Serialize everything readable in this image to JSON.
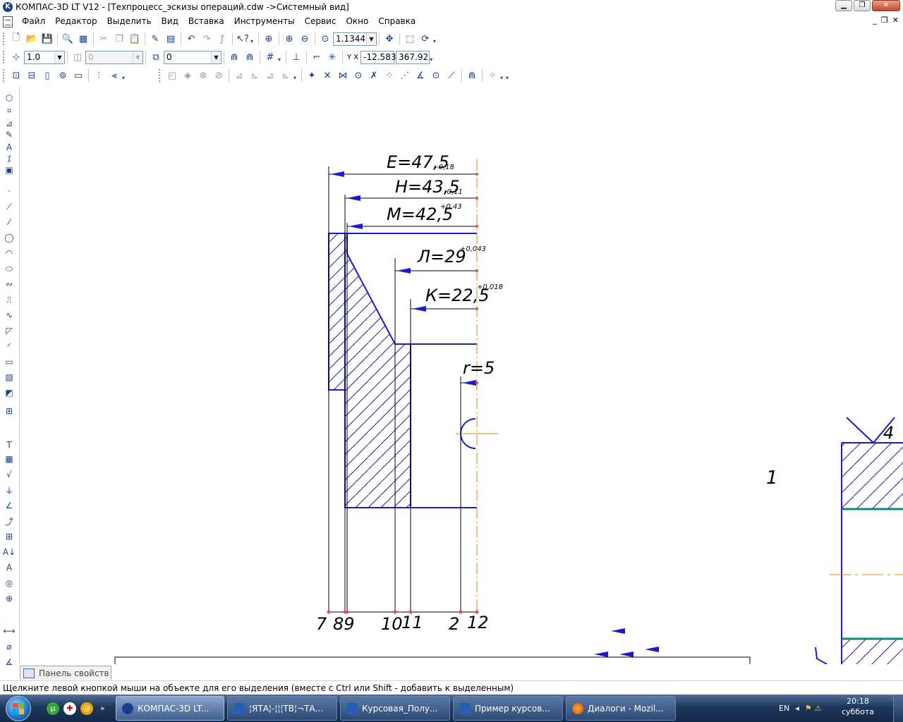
{
  "window": {
    "title": "КОМПАС-3D LT V12 - [Техпроцесс_эскизы операций.cdw ->Системный вид]"
  },
  "menu": {
    "items": [
      "Файл",
      "Редактор",
      "Выделить",
      "Вид",
      "Вставка",
      "Инструменты",
      "Сервис",
      "Окно",
      "Справка"
    ]
  },
  "toolbar": {
    "zoom_value": "1.1344",
    "line_step": "1.0",
    "angle_step": "0",
    "layer": "0",
    "coord_x": "-12.583",
    "coord_y": "367.92",
    "xy_label": "Y X"
  },
  "drawing": {
    "dim_E": "Е=47,5",
    "tol_E": "-0,18",
    "dim_H": "Н=43,5",
    "tol_H": "-0,11",
    "dim_M": "М=42,5",
    "tol_M": "+0,43",
    "dim_L": "Л=29",
    "tol_L": "+0,043",
    "dim_K": "К=22,5",
    "tol_K": "+0,018",
    "dim_r": "r=5",
    "surf_7": "7",
    "surf_89": "89",
    "surf_10": "10",
    "surf_11": "11",
    "surf_2": "2",
    "surf_12": "12",
    "label_1": "1",
    "label_4": "4"
  },
  "properties_panel": {
    "label": "Панель свойств"
  },
  "status": {
    "text": "Щелкните левой кнопкой мыши на объекте для его выделения (вместе с Ctrl или Shift - добавить к выделенным)"
  },
  "taskbar": {
    "tasks": [
      "КОМПАС-3D LT...",
      "¦ЯТА¦-¦¦¦ТВ¦¬ТА...",
      "Курсовая_Полу...",
      "Пример курсов...",
      "Диалоги - Mozil..."
    ],
    "quick_more": "»",
    "lang": "EN",
    "time": "20:18",
    "day": "суббота"
  },
  "colors": {
    "drawing_line": "#1a1ad0",
    "axis_line": "#d28a00",
    "hatch_bar": "#0a8a7a",
    "point": "#e05050"
  }
}
